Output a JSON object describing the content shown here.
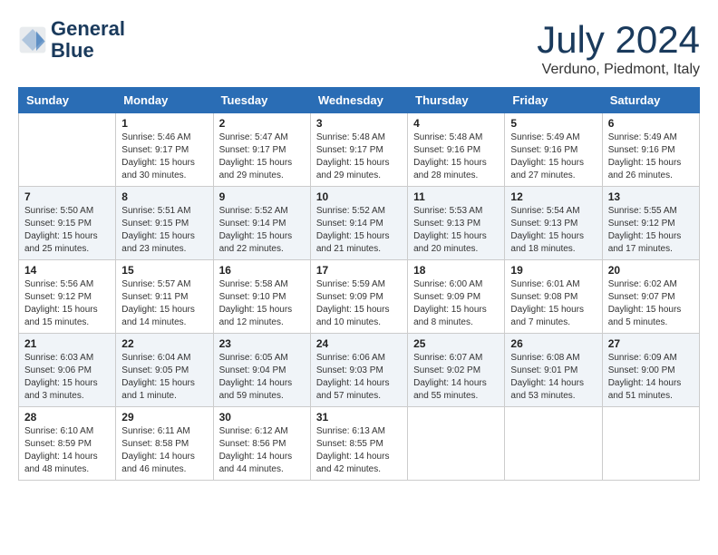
{
  "header": {
    "logo_line1": "General",
    "logo_line2": "Blue",
    "month": "July 2024",
    "location": "Verduno, Piedmont, Italy"
  },
  "weekdays": [
    "Sunday",
    "Monday",
    "Tuesday",
    "Wednesday",
    "Thursday",
    "Friday",
    "Saturday"
  ],
  "weeks": [
    [
      {
        "day": "",
        "sunrise": "",
        "sunset": "",
        "daylight": ""
      },
      {
        "day": "1",
        "sunrise": "Sunrise: 5:46 AM",
        "sunset": "Sunset: 9:17 PM",
        "daylight": "Daylight: 15 hours and 30 minutes."
      },
      {
        "day": "2",
        "sunrise": "Sunrise: 5:47 AM",
        "sunset": "Sunset: 9:17 PM",
        "daylight": "Daylight: 15 hours and 29 minutes."
      },
      {
        "day": "3",
        "sunrise": "Sunrise: 5:48 AM",
        "sunset": "Sunset: 9:17 PM",
        "daylight": "Daylight: 15 hours and 29 minutes."
      },
      {
        "day": "4",
        "sunrise": "Sunrise: 5:48 AM",
        "sunset": "Sunset: 9:16 PM",
        "daylight": "Daylight: 15 hours and 28 minutes."
      },
      {
        "day": "5",
        "sunrise": "Sunrise: 5:49 AM",
        "sunset": "Sunset: 9:16 PM",
        "daylight": "Daylight: 15 hours and 27 minutes."
      },
      {
        "day": "6",
        "sunrise": "Sunrise: 5:49 AM",
        "sunset": "Sunset: 9:16 PM",
        "daylight": "Daylight: 15 hours and 26 minutes."
      }
    ],
    [
      {
        "day": "7",
        "sunrise": "Sunrise: 5:50 AM",
        "sunset": "Sunset: 9:15 PM",
        "daylight": "Daylight: 15 hours and 25 minutes."
      },
      {
        "day": "8",
        "sunrise": "Sunrise: 5:51 AM",
        "sunset": "Sunset: 9:15 PM",
        "daylight": "Daylight: 15 hours and 23 minutes."
      },
      {
        "day": "9",
        "sunrise": "Sunrise: 5:52 AM",
        "sunset": "Sunset: 9:14 PM",
        "daylight": "Daylight: 15 hours and 22 minutes."
      },
      {
        "day": "10",
        "sunrise": "Sunrise: 5:52 AM",
        "sunset": "Sunset: 9:14 PM",
        "daylight": "Daylight: 15 hours and 21 minutes."
      },
      {
        "day": "11",
        "sunrise": "Sunrise: 5:53 AM",
        "sunset": "Sunset: 9:13 PM",
        "daylight": "Daylight: 15 hours and 20 minutes."
      },
      {
        "day": "12",
        "sunrise": "Sunrise: 5:54 AM",
        "sunset": "Sunset: 9:13 PM",
        "daylight": "Daylight: 15 hours and 18 minutes."
      },
      {
        "day": "13",
        "sunrise": "Sunrise: 5:55 AM",
        "sunset": "Sunset: 9:12 PM",
        "daylight": "Daylight: 15 hours and 17 minutes."
      }
    ],
    [
      {
        "day": "14",
        "sunrise": "Sunrise: 5:56 AM",
        "sunset": "Sunset: 9:12 PM",
        "daylight": "Daylight: 15 hours and 15 minutes."
      },
      {
        "day": "15",
        "sunrise": "Sunrise: 5:57 AM",
        "sunset": "Sunset: 9:11 PM",
        "daylight": "Daylight: 15 hours and 14 minutes."
      },
      {
        "day": "16",
        "sunrise": "Sunrise: 5:58 AM",
        "sunset": "Sunset: 9:10 PM",
        "daylight": "Daylight: 15 hours and 12 minutes."
      },
      {
        "day": "17",
        "sunrise": "Sunrise: 5:59 AM",
        "sunset": "Sunset: 9:09 PM",
        "daylight": "Daylight: 15 hours and 10 minutes."
      },
      {
        "day": "18",
        "sunrise": "Sunrise: 6:00 AM",
        "sunset": "Sunset: 9:09 PM",
        "daylight": "Daylight: 15 hours and 8 minutes."
      },
      {
        "day": "19",
        "sunrise": "Sunrise: 6:01 AM",
        "sunset": "Sunset: 9:08 PM",
        "daylight": "Daylight: 15 hours and 7 minutes."
      },
      {
        "day": "20",
        "sunrise": "Sunrise: 6:02 AM",
        "sunset": "Sunset: 9:07 PM",
        "daylight": "Daylight: 15 hours and 5 minutes."
      }
    ],
    [
      {
        "day": "21",
        "sunrise": "Sunrise: 6:03 AM",
        "sunset": "Sunset: 9:06 PM",
        "daylight": "Daylight: 15 hours and 3 minutes."
      },
      {
        "day": "22",
        "sunrise": "Sunrise: 6:04 AM",
        "sunset": "Sunset: 9:05 PM",
        "daylight": "Daylight: 15 hours and 1 minute."
      },
      {
        "day": "23",
        "sunrise": "Sunrise: 6:05 AM",
        "sunset": "Sunset: 9:04 PM",
        "daylight": "Daylight: 14 hours and 59 minutes."
      },
      {
        "day": "24",
        "sunrise": "Sunrise: 6:06 AM",
        "sunset": "Sunset: 9:03 PM",
        "daylight": "Daylight: 14 hours and 57 minutes."
      },
      {
        "day": "25",
        "sunrise": "Sunrise: 6:07 AM",
        "sunset": "Sunset: 9:02 PM",
        "daylight": "Daylight: 14 hours and 55 minutes."
      },
      {
        "day": "26",
        "sunrise": "Sunrise: 6:08 AM",
        "sunset": "Sunset: 9:01 PM",
        "daylight": "Daylight: 14 hours and 53 minutes."
      },
      {
        "day": "27",
        "sunrise": "Sunrise: 6:09 AM",
        "sunset": "Sunset: 9:00 PM",
        "daylight": "Daylight: 14 hours and 51 minutes."
      }
    ],
    [
      {
        "day": "28",
        "sunrise": "Sunrise: 6:10 AM",
        "sunset": "Sunset: 8:59 PM",
        "daylight": "Daylight: 14 hours and 48 minutes."
      },
      {
        "day": "29",
        "sunrise": "Sunrise: 6:11 AM",
        "sunset": "Sunset: 8:58 PM",
        "daylight": "Daylight: 14 hours and 46 minutes."
      },
      {
        "day": "30",
        "sunrise": "Sunrise: 6:12 AM",
        "sunset": "Sunset: 8:56 PM",
        "daylight": "Daylight: 14 hours and 44 minutes."
      },
      {
        "day": "31",
        "sunrise": "Sunrise: 6:13 AM",
        "sunset": "Sunset: 8:55 PM",
        "daylight": "Daylight: 14 hours and 42 minutes."
      },
      {
        "day": "",
        "sunrise": "",
        "sunset": "",
        "daylight": ""
      },
      {
        "day": "",
        "sunrise": "",
        "sunset": "",
        "daylight": ""
      },
      {
        "day": "",
        "sunrise": "",
        "sunset": "",
        "daylight": ""
      }
    ]
  ]
}
